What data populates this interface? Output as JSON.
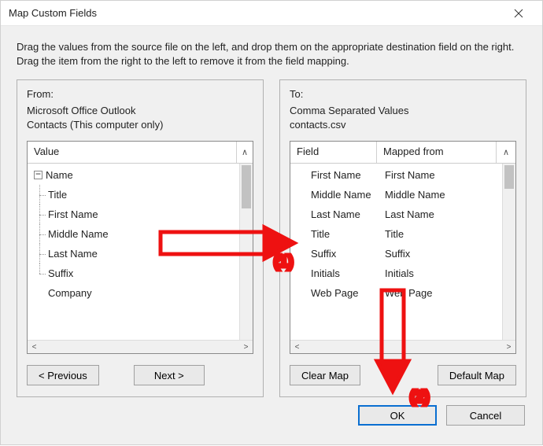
{
  "title": "Map Custom Fields",
  "instructions": "Drag the values from the source file on the left, and drop them on the appropriate destination field on the right.  Drag the item from the right to the left to remove it from the field mapping.",
  "from": {
    "label": "From:",
    "source": "Microsoft Office Outlook",
    "subset": "Contacts (This computer only)",
    "header": "Value",
    "root": "Name",
    "items": [
      "Title",
      "First Name",
      "Middle Name",
      "Last Name",
      "Suffix"
    ],
    "trailing": "Company"
  },
  "to": {
    "label": "To:",
    "target": "Comma Separated Values",
    "file": "contacts.csv",
    "headers": {
      "field": "Field",
      "mapped": "Mapped from"
    },
    "rows": [
      {
        "field": "First Name",
        "mapped": "First Name"
      },
      {
        "field": "Middle Name",
        "mapped": "Middle Name"
      },
      {
        "field": "Last Name",
        "mapped": "Last Name"
      },
      {
        "field": "Title",
        "mapped": "Title"
      },
      {
        "field": "Suffix",
        "mapped": "Suffix"
      },
      {
        "field": "Initials",
        "mapped": "Initials"
      },
      {
        "field": "Web Page",
        "mapped": "Web Page"
      }
    ]
  },
  "buttons": {
    "previous": "< Previous",
    "next": "Next >",
    "clear_map": "Clear Map",
    "default_map": "Default Map",
    "ok": "OK",
    "cancel": "Cancel"
  },
  "annotations": {
    "step1": "(1)",
    "step2": "(2)"
  },
  "glyphs": {
    "minus": "−",
    "up_caret": "∧",
    "left_arrow": "<",
    "right_arrow": ">"
  }
}
